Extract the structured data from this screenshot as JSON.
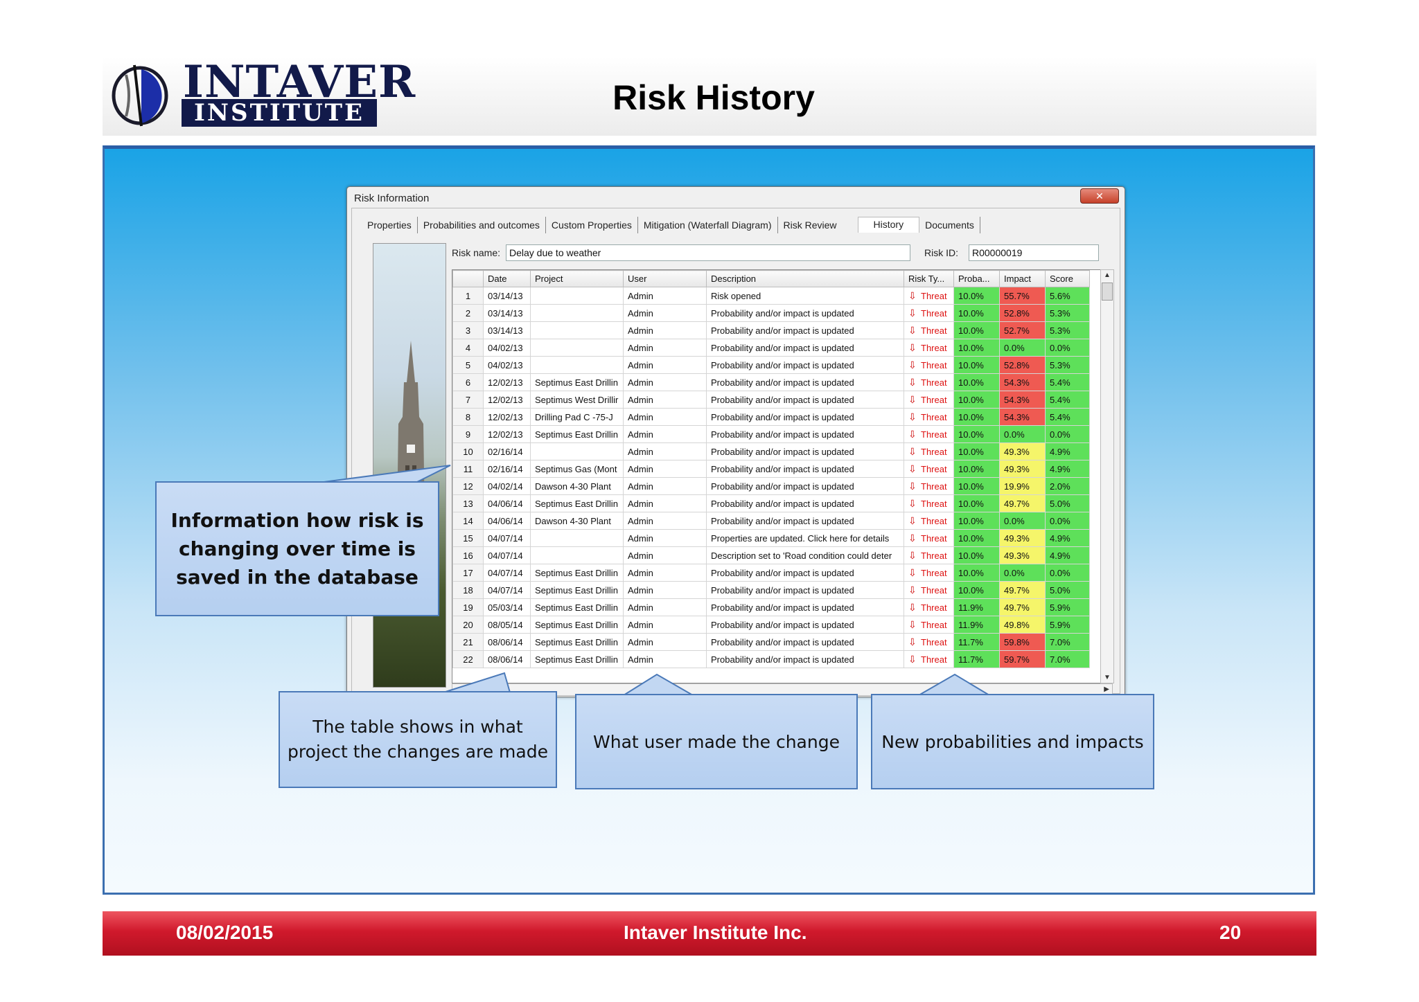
{
  "header": {
    "logo_line1": "INTAVER",
    "logo_line2": "INSTITUTE",
    "title": "Risk History"
  },
  "dialog": {
    "title": "Risk Information",
    "close_label": "✕",
    "tabs": [
      {
        "label": "Properties"
      },
      {
        "label": "Probabilities and outcomes"
      },
      {
        "label": "Custom Properties"
      },
      {
        "label": "Mitigation (Waterfall Diagram)"
      },
      {
        "label": "Risk Review"
      },
      {
        "label": "History",
        "active": true
      },
      {
        "label": "Documents"
      }
    ],
    "risk_name_label": "Risk name:",
    "risk_name_value": "Delay due to weather",
    "risk_id_label": "Risk ID:",
    "risk_id_value": "R00000019",
    "columns": [
      "Date",
      "Project",
      "User",
      "Description",
      "Risk Ty...",
      "Proba...",
      "Impact",
      "Score"
    ],
    "rows": [
      {
        "n": "1",
        "date": "03/14/13",
        "project": "",
        "user": "Admin",
        "desc": "Risk opened",
        "type": "Threat",
        "prob": "10.0%",
        "impact": "55.7%",
        "impact_color": "red",
        "score": "5.6%"
      },
      {
        "n": "2",
        "date": "03/14/13",
        "project": "",
        "user": "Admin",
        "desc": "Probability and/or impact is updated",
        "type": "Threat",
        "prob": "10.0%",
        "impact": "52.8%",
        "impact_color": "red",
        "score": "5.3%"
      },
      {
        "n": "3",
        "date": "03/14/13",
        "project": "",
        "user": "Admin",
        "desc": "Probability and/or impact is updated",
        "type": "Threat",
        "prob": "10.0%",
        "impact": "52.7%",
        "impact_color": "red",
        "score": "5.3%"
      },
      {
        "n": "4",
        "date": "04/02/13",
        "project": "",
        "user": "Admin",
        "desc": "Probability and/or impact is updated",
        "type": "Threat",
        "prob": "10.0%",
        "impact": "0.0%",
        "impact_color": "green",
        "score": "0.0%"
      },
      {
        "n": "5",
        "date": "04/02/13",
        "project": "",
        "user": "Admin",
        "desc": "Probability and/or impact is updated",
        "type": "Threat",
        "prob": "10.0%",
        "impact": "52.8%",
        "impact_color": "red",
        "score": "5.3%"
      },
      {
        "n": "6",
        "date": "12/02/13",
        "project": "Septimus East Drillin",
        "user": "Admin",
        "desc": "Probability and/or impact is updated",
        "type": "Threat",
        "prob": "10.0%",
        "impact": "54.3%",
        "impact_color": "red",
        "score": "5.4%"
      },
      {
        "n": "7",
        "date": "12/02/13",
        "project": "Septimus West Drillir",
        "user": "Admin",
        "desc": "Probability and/or impact is updated",
        "type": "Threat",
        "prob": "10.0%",
        "impact": "54.3%",
        "impact_color": "red",
        "score": "5.4%"
      },
      {
        "n": "8",
        "date": "12/02/13",
        "project": "Drilling Pad C -75-J",
        "user": "Admin",
        "desc": "Probability and/or impact is updated",
        "type": "Threat",
        "prob": "10.0%",
        "impact": "54.3%",
        "impact_color": "red",
        "score": "5.4%"
      },
      {
        "n": "9",
        "date": "12/02/13",
        "project": "Septimus East Drillin",
        "user": "Admin",
        "desc": "Probability and/or impact is updated",
        "type": "Threat",
        "prob": "10.0%",
        "impact": "0.0%",
        "impact_color": "green",
        "score": "0.0%"
      },
      {
        "n": "10",
        "date": "02/16/14",
        "project": "",
        "user": "Admin",
        "desc": "Probability and/or impact is updated",
        "type": "Threat",
        "prob": "10.0%",
        "impact": "49.3%",
        "impact_color": "yellow",
        "score": "4.9%"
      },
      {
        "n": "11",
        "date": "02/16/14",
        "project": "Septimus Gas (Mont",
        "user": "Admin",
        "desc": "Probability and/or impact is updated",
        "type": "Threat",
        "prob": "10.0%",
        "impact": "49.3%",
        "impact_color": "yellow",
        "score": "4.9%"
      },
      {
        "n": "12",
        "date": "04/02/14",
        "project": "Dawson 4-30 Plant",
        "user": "Admin",
        "desc": "Probability and/or impact is updated",
        "type": "Threat",
        "prob": "10.0%",
        "impact": "19.9%",
        "impact_color": "yellow",
        "score": "2.0%"
      },
      {
        "n": "13",
        "date": "04/06/14",
        "project": "Septimus East Drillin",
        "user": "Admin",
        "desc": "Probability and/or impact is updated",
        "type": "Threat",
        "prob": "10.0%",
        "impact": "49.7%",
        "impact_color": "yellow",
        "score": "5.0%"
      },
      {
        "n": "14",
        "date": "04/06/14",
        "project": "Dawson 4-30 Plant",
        "user": "Admin",
        "desc": "Probability and/or impact is updated",
        "type": "Threat",
        "prob": "10.0%",
        "impact": "0.0%",
        "impact_color": "green",
        "score": "0.0%"
      },
      {
        "n": "15",
        "date": "04/07/14",
        "project": "",
        "user": "Admin",
        "desc": "Properties are updated. Click here for details",
        "type": "Threat",
        "prob": "10.0%",
        "impact": "49.3%",
        "impact_color": "yellow",
        "score": "4.9%"
      },
      {
        "n": "16",
        "date": "04/07/14",
        "project": "",
        "user": "Admin",
        "desc": "Description set to 'Road condition could deter",
        "type": "Threat",
        "prob": "10.0%",
        "impact": "49.3%",
        "impact_color": "yellow",
        "score": "4.9%"
      },
      {
        "n": "17",
        "date": "04/07/14",
        "project": "Septimus East Drillin",
        "user": "Admin",
        "desc": "Probability and/or impact is updated",
        "type": "Threat",
        "prob": "10.0%",
        "impact": "0.0%",
        "impact_color": "green",
        "score": "0.0%"
      },
      {
        "n": "18",
        "date": "04/07/14",
        "project": "Septimus East Drillin",
        "user": "Admin",
        "desc": "Probability and/or impact is updated",
        "type": "Threat",
        "prob": "10.0%",
        "impact": "49.7%",
        "impact_color": "yellow",
        "score": "5.0%"
      },
      {
        "n": "19",
        "date": "05/03/14",
        "project": "Septimus East Drillin",
        "user": "Admin",
        "desc": "Probability and/or impact is updated",
        "type": "Threat",
        "prob": "11.9%",
        "impact": "49.7%",
        "impact_color": "yellow",
        "score": "5.9%"
      },
      {
        "n": "20",
        "date": "08/05/14",
        "project": "Septimus East Drillin",
        "user": "Admin",
        "desc": "Probability and/or impact is updated",
        "type": "Threat",
        "prob": "11.9%",
        "impact": "49.8%",
        "impact_color": "yellow",
        "score": "5.9%"
      },
      {
        "n": "21",
        "date": "08/06/14",
        "project": "Septimus East Drillin",
        "user": "Admin",
        "desc": "Probability and/or impact is updated",
        "type": "Threat",
        "prob": "11.7%",
        "impact": "59.8%",
        "impact_color": "red",
        "score": "7.0%"
      },
      {
        "n": "22",
        "date": "08/06/14",
        "project": "Septimus East Drillin",
        "user": "Admin",
        "desc": "Probability and/or impact is updated",
        "type": "Threat",
        "prob": "11.7%",
        "impact": "59.7%",
        "impact_color": "red",
        "score": "7.0%"
      }
    ]
  },
  "callouts": {
    "left": "Information how risk is changing over time is saved in the database",
    "project": "The table shows in what project the changes are made",
    "user": "What user made the change",
    "probabilities": "New probabilities and impacts"
  },
  "footer": {
    "date": "08/02/2015",
    "company": "Intaver Institute Inc.",
    "page": "20"
  },
  "colors": {
    "threat_text": "#dd1111",
    "cell_green": "#5ee05a",
    "cell_red": "#ef5a52",
    "cell_yellow": "#f5f56a",
    "footer_red": "#c8162a",
    "logo_navy": "#121a4a"
  },
  "icons": [
    "risk-arrow-down-icon",
    "close-icon",
    "scroll-up-icon",
    "scroll-down-icon",
    "scroll-left-icon",
    "scroll-right-icon"
  ]
}
